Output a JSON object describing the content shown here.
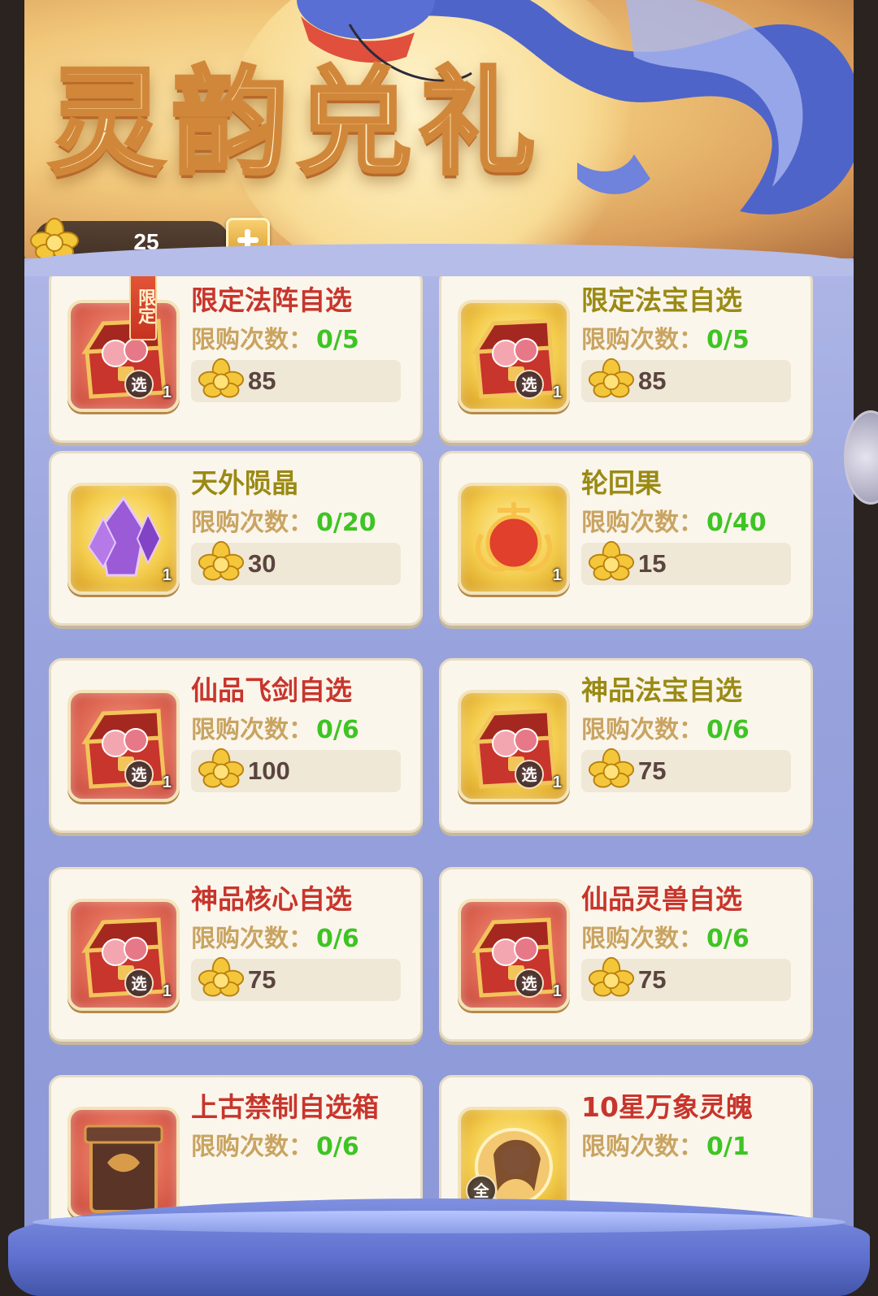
{
  "banner": {
    "title": "灵韵兑礼"
  },
  "currency": {
    "icon": "gold-lotus-icon",
    "amount": "25",
    "add_icon": "plus-icon"
  },
  "labels": {
    "limit_prefix": "限购次数：",
    "limited_tag": "限定",
    "select_badge": "选",
    "all_badge": "全"
  },
  "items": [
    {
      "name": "限定法阵自选",
      "name_color": "red",
      "frame": "red",
      "icon": "treasure-chest-icon",
      "limit": "0/5",
      "price": "85",
      "count": "1",
      "badge": "select",
      "limited": true
    },
    {
      "name": "限定法宝自选",
      "name_color": "olive",
      "frame": "gold",
      "icon": "treasure-chest-icon",
      "limit": "0/5",
      "price": "85",
      "count": "1",
      "badge": "select"
    },
    {
      "name": "天外陨晶",
      "name_color": "olive",
      "frame": "gold",
      "icon": "purple-crystal-icon",
      "limit": "0/20",
      "price": "30",
      "count": "1"
    },
    {
      "name": "轮回果",
      "name_color": "olive",
      "frame": "gold",
      "icon": "red-fruit-icon",
      "limit": "0/40",
      "price": "15",
      "count": "1"
    },
    {
      "name": "仙品飞剑自选",
      "name_color": "red",
      "frame": "red",
      "icon": "treasure-chest-icon",
      "limit": "0/6",
      "price": "100",
      "count": "1",
      "badge": "select"
    },
    {
      "name": "神品法宝自选",
      "name_color": "olive",
      "frame": "gold",
      "icon": "treasure-chest-icon",
      "limit": "0/6",
      "price": "75",
      "count": "1",
      "badge": "select"
    },
    {
      "name": "神品核心自选",
      "name_color": "red",
      "frame": "red",
      "icon": "treasure-chest-icon",
      "limit": "0/6",
      "price": "75",
      "count": "1",
      "badge": "select"
    },
    {
      "name": "仙品灵兽自选",
      "name_color": "red",
      "frame": "red",
      "icon": "treasure-chest-icon",
      "limit": "0/6",
      "price": "75",
      "count": "1",
      "badge": "select"
    },
    {
      "name": "上古禁制自选箱",
      "name_color": "red",
      "frame": "red",
      "icon": "ancient-box-icon",
      "limit": "0/6"
    },
    {
      "name": "10星万象灵魄",
      "name_color": "red",
      "frame": "gold",
      "icon": "spirit-portrait-icon",
      "limit": "0/1",
      "badge": "all"
    }
  ]
}
